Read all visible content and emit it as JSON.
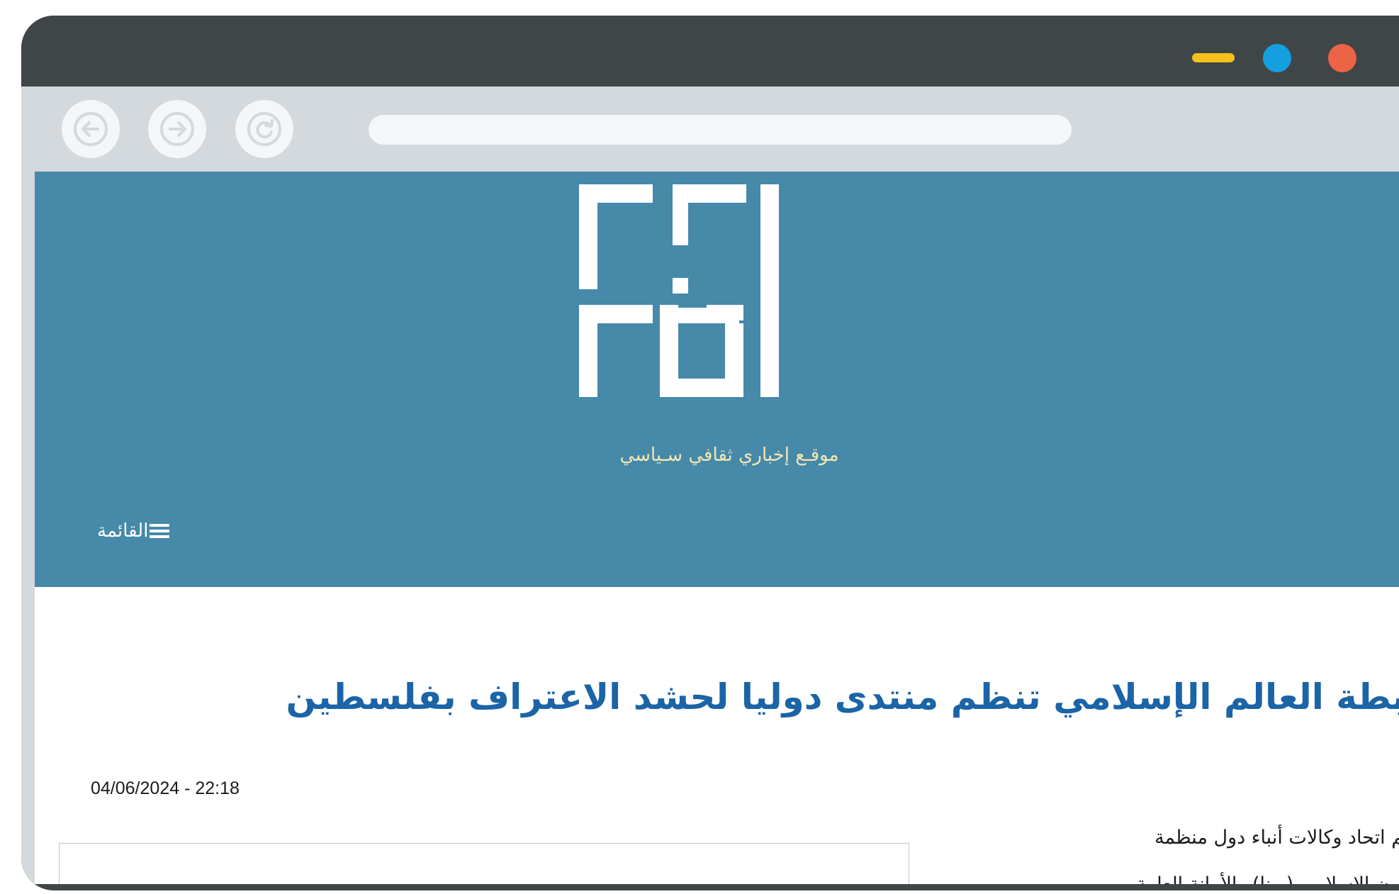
{
  "colors": {
    "frame": "#404647",
    "toolbar": "#d3d9dc",
    "header_bg": "#4689a9",
    "headline": "#1b64a6",
    "tagline": "#f2e7b2",
    "win_minimize": "#f6c21a",
    "win_maximize": "#149fe0",
    "win_close": "#ec6346"
  },
  "browser": {
    "buttons": {
      "minimize": "minimize-icon",
      "maximize": "maximize-icon",
      "close": "close-icon"
    },
    "nav": {
      "back_icon": "arrow-left-icon",
      "forward_icon": "arrow-right-icon",
      "reload_icon": "reload-icon"
    },
    "address": ""
  },
  "site": {
    "logo_icon": "kufic-logo-icon",
    "tagline": "موقـع إخباري ثقافي سـياسي",
    "menu_label": "القائمة",
    "menu_icon": "hamburger-icon"
  },
  "article": {
    "headline": "رابطة العالم الإسلامي تنظم منتدى دوليا لحشد الاعتراف بفلسطين",
    "date": "04/06/2024 - 22:18",
    "body_lines": [
      "ينظم اتحاد وكالات أنباء دول منظمة",
      "التعاون الإسلامي (يونا) والأمانة العامة"
    ]
  }
}
